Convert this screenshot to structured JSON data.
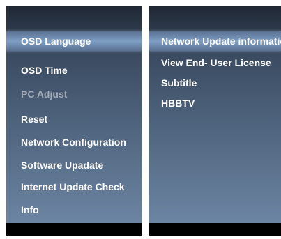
{
  "left_menu": {
    "selected_index": 0,
    "items": [
      {
        "label": "OSD Language",
        "state": "selected"
      },
      {
        "label": "OSD Time",
        "state": "normal"
      },
      {
        "label": "PC Adjust",
        "state": "disabled"
      },
      {
        "label": "Reset",
        "state": "normal"
      },
      {
        "label": "Network Configuration",
        "state": "normal"
      },
      {
        "label": "Software Upadate",
        "state": "normal"
      },
      {
        "label": "Internet Update Check",
        "state": "normal"
      },
      {
        "label": "Info",
        "state": "normal"
      }
    ]
  },
  "right_menu": {
    "items": [
      {
        "label": "Network Update information",
        "state": "normal"
      },
      {
        "label": "View End- User License",
        "state": "normal"
      },
      {
        "label": "Subtitle",
        "state": "normal"
      },
      {
        "label": "HBBTV",
        "state": "normal"
      }
    ]
  },
  "colors": {
    "text": "#ffffff",
    "disabled_text": "#a3acb8",
    "highlight": "#7e9ec3",
    "panel_top": "#1f2733",
    "panel_bottom": "#6c85a2",
    "footer": "#000000"
  }
}
